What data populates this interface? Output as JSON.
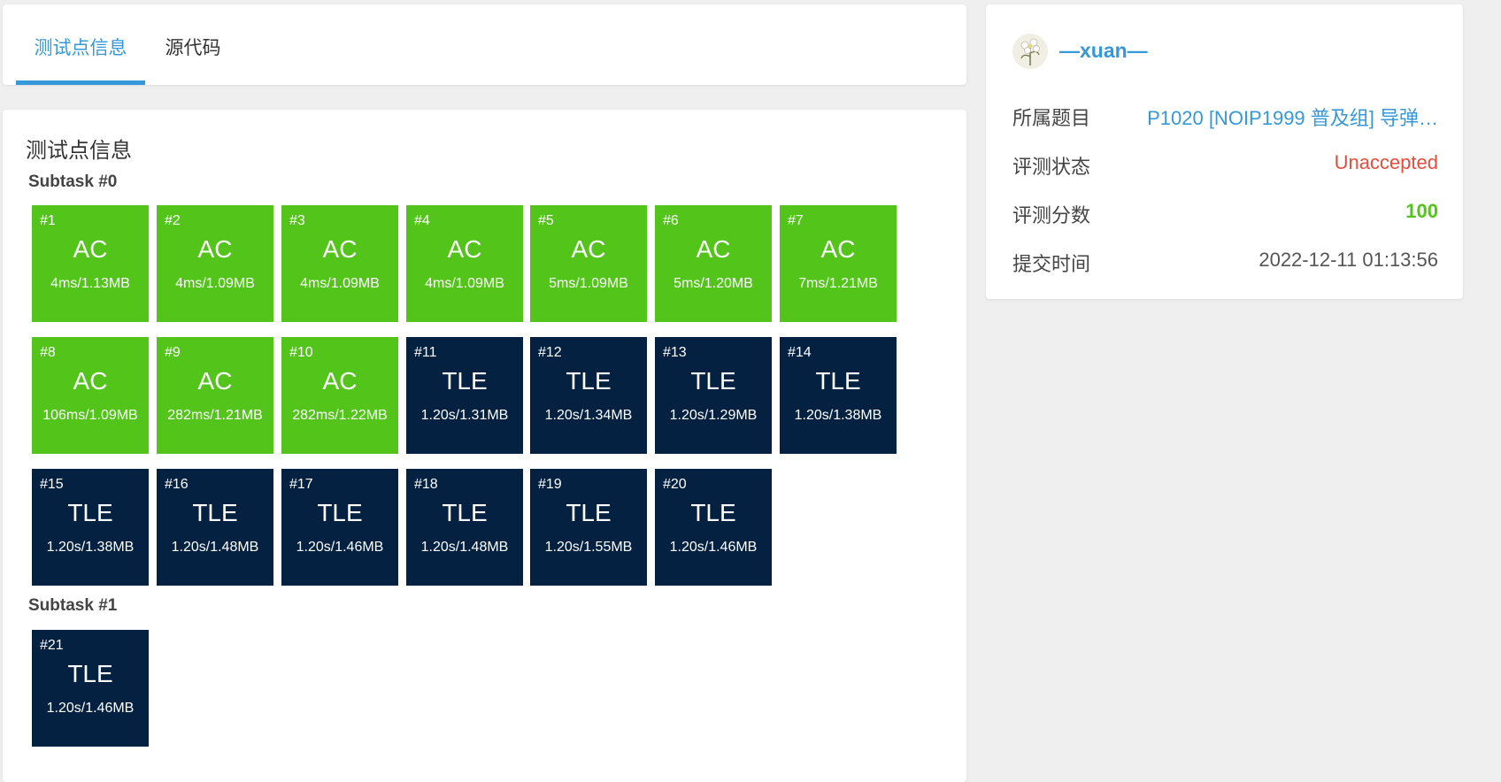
{
  "tabs": [
    {
      "label": "测试点信息",
      "active": true
    },
    {
      "label": "源代码",
      "active": false
    }
  ],
  "section_title": "测试点信息",
  "subtasks": [
    {
      "title": "Subtask #0",
      "cases": [
        {
          "num": "#1",
          "status": "AC",
          "result": "4ms/1.13MB"
        },
        {
          "num": "#2",
          "status": "AC",
          "result": "4ms/1.09MB"
        },
        {
          "num": "#3",
          "status": "AC",
          "result": "4ms/1.09MB"
        },
        {
          "num": "#4",
          "status": "AC",
          "result": "4ms/1.09MB"
        },
        {
          "num": "#5",
          "status": "AC",
          "result": "5ms/1.09MB"
        },
        {
          "num": "#6",
          "status": "AC",
          "result": "5ms/1.20MB"
        },
        {
          "num": "#7",
          "status": "AC",
          "result": "7ms/1.21MB"
        },
        {
          "num": "#8",
          "status": "AC",
          "result": "106ms/1.09MB"
        },
        {
          "num": "#9",
          "status": "AC",
          "result": "282ms/1.21MB"
        },
        {
          "num": "#10",
          "status": "AC",
          "result": "282ms/1.22MB"
        },
        {
          "num": "#11",
          "status": "TLE",
          "result": "1.20s/1.31MB"
        },
        {
          "num": "#12",
          "status": "TLE",
          "result": "1.20s/1.34MB"
        },
        {
          "num": "#13",
          "status": "TLE",
          "result": "1.20s/1.29MB"
        },
        {
          "num": "#14",
          "status": "TLE",
          "result": "1.20s/1.38MB"
        },
        {
          "num": "#15",
          "status": "TLE",
          "result": "1.20s/1.38MB"
        },
        {
          "num": "#16",
          "status": "TLE",
          "result": "1.20s/1.48MB"
        },
        {
          "num": "#17",
          "status": "TLE",
          "result": "1.20s/1.46MB"
        },
        {
          "num": "#18",
          "status": "TLE",
          "result": "1.20s/1.48MB"
        },
        {
          "num": "#19",
          "status": "TLE",
          "result": "1.20s/1.55MB"
        },
        {
          "num": "#20",
          "status": "TLE",
          "result": "1.20s/1.46MB"
        }
      ]
    },
    {
      "title": "Subtask #1",
      "cases": [
        {
          "num": "#21",
          "status": "TLE",
          "result": "1.20s/1.46MB"
        }
      ]
    }
  ],
  "sidebar": {
    "username": "—xuan—",
    "rows": [
      {
        "label": "所属题目",
        "value": "P1020 [NOIP1999 普及组] 导弹…"
      },
      {
        "label": "评测状态",
        "value": "Unaccepted"
      },
      {
        "label": "评测分数",
        "value": "100"
      },
      {
        "label": "提交时间",
        "value": "2022-12-11 01:13:56"
      }
    ]
  },
  "colors": {
    "accent": "#3498db",
    "ac": "#52c41a",
    "tle": "#052142",
    "unaccepted": "#e74c3c"
  },
  "icons": {
    "avatar": "flower-avatar-icon"
  }
}
